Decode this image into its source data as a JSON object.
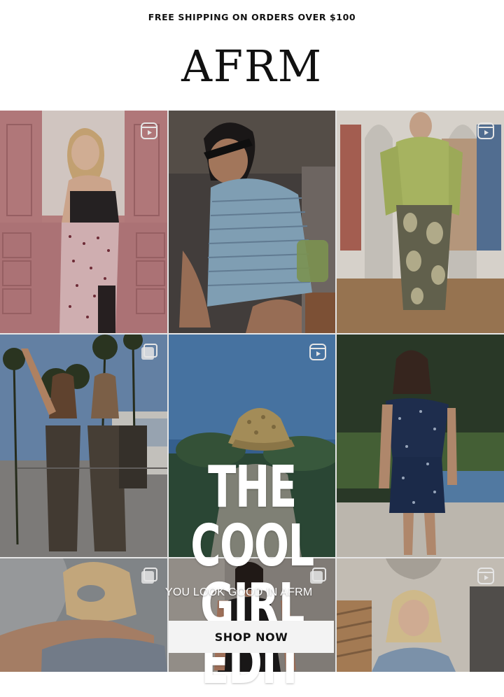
{
  "announcement": "FREE SHIPPING ON ORDERS OVER $100",
  "brand": "AFRM",
  "hero": {
    "headline_line1": "THE COOL",
    "headline_line2": "GIRL EDIT",
    "subline": "YOU LOOK GOOD IN AFRM",
    "cta_label": "SHOP NOW"
  },
  "tiles": [
    {
      "id": 1,
      "subject": "woman in pink polka dot skirt",
      "badge": "reel-icon"
    },
    {
      "id": 2,
      "subject": "woman in striped top with sunglasses",
      "badge": "none"
    },
    {
      "id": 3,
      "subject": "woman in green blouse and snakeskin skirt",
      "badge": "reel-icon"
    },
    {
      "id": 4,
      "subject": "two women in animal print sets",
      "badge": "multi-photo-icon"
    },
    {
      "id": 5,
      "subject": "bucket hat by the ocean",
      "badge": "reel-icon"
    },
    {
      "id": 6,
      "subject": "woman in navy star dress by pool",
      "badge": "none"
    },
    {
      "id": 7,
      "subject": "woman lounging with straw hat",
      "badge": "multi-photo-icon"
    },
    {
      "id": 8,
      "subject": "woman in black top",
      "badge": "multi-photo-icon"
    },
    {
      "id": 9,
      "subject": "blonde woman in denim",
      "badge": "reel-icon"
    }
  ]
}
